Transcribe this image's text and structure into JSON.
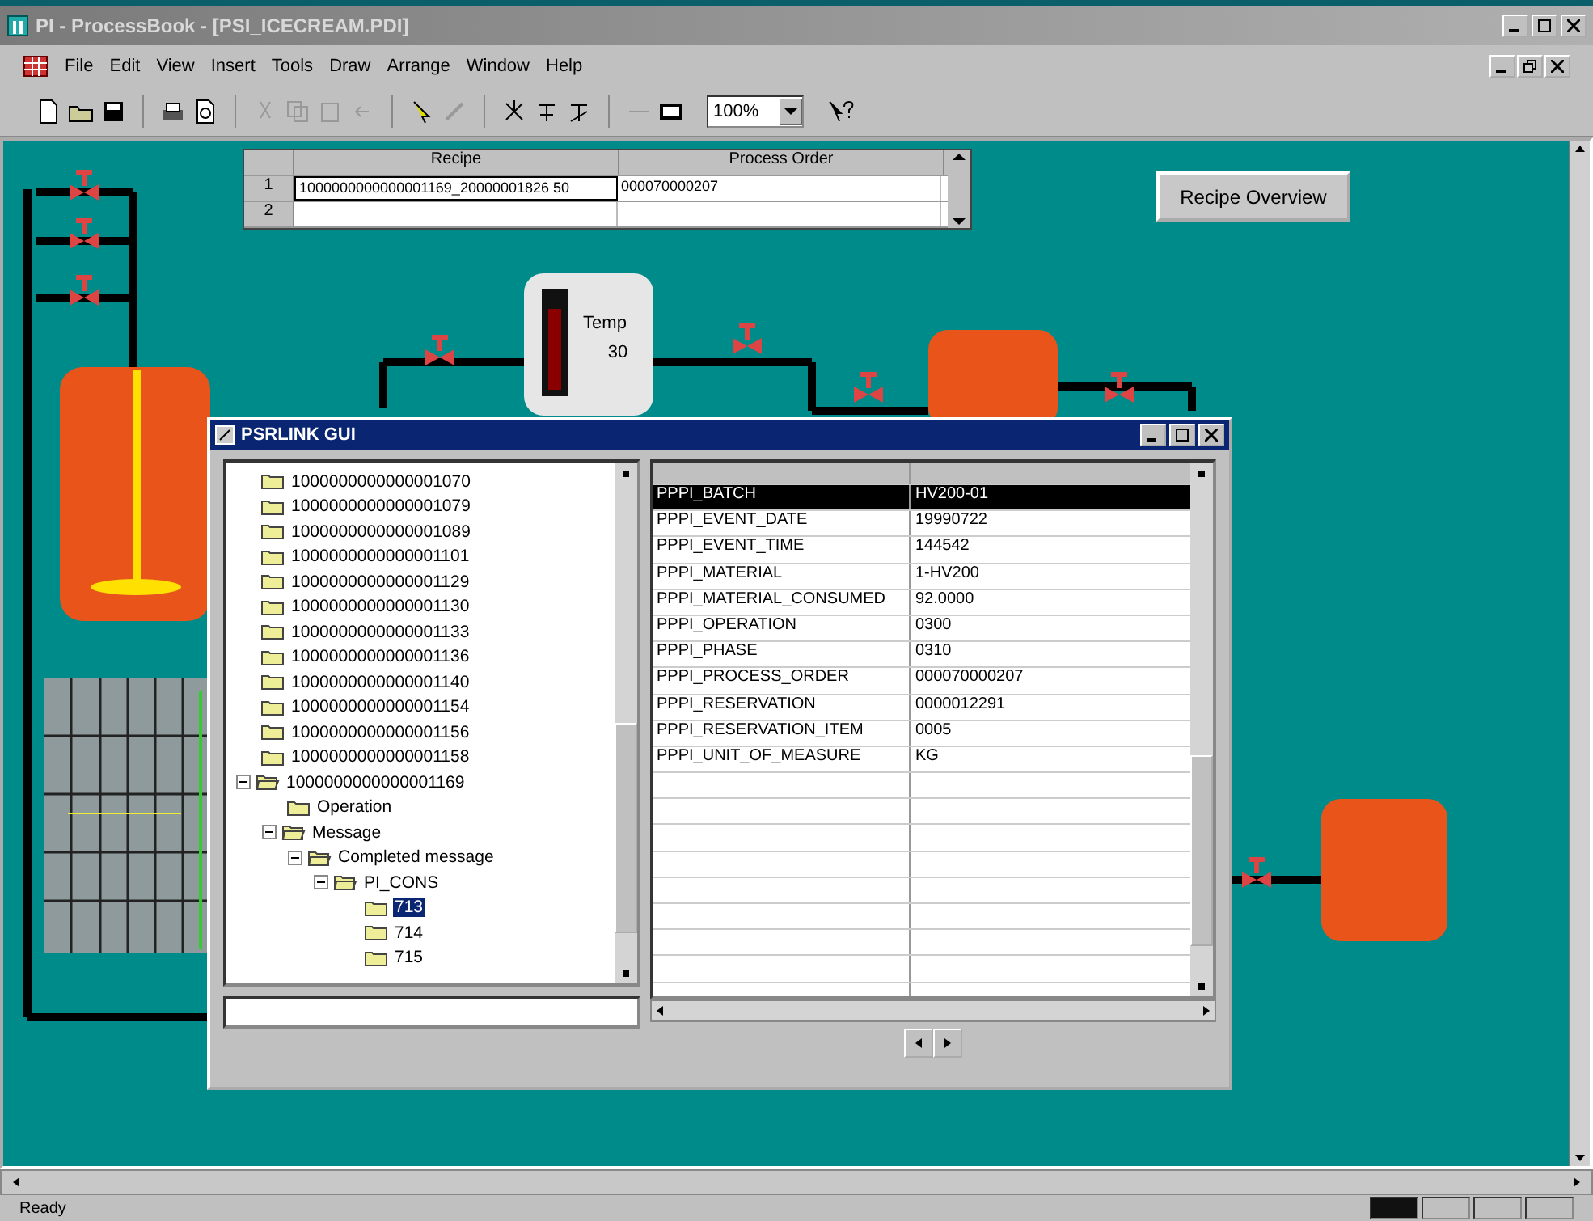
{
  "window": {
    "title": "PI - ProcessBook - [PSI_ICECREAM.PDI]"
  },
  "menu": [
    "File",
    "Edit",
    "View",
    "Insert",
    "Tools",
    "Draw",
    "Arrange",
    "Window",
    "Help"
  ],
  "toolbar": {
    "zoom": "100%"
  },
  "recipe_grid": {
    "columns": [
      "Recipe",
      "Process Order"
    ],
    "rows": [
      {
        "number": "1",
        "recipe": "1000000000000001169_20000001826 50",
        "process_order": "000070000207",
        "selected": true
      },
      {
        "number": "2",
        "selected": false
      }
    ]
  },
  "recipe_overview_button": "Recipe Overview",
  "temp_tank": {
    "label": "Temp",
    "value": "30"
  },
  "dialog": {
    "title": "PSRLINK GUI",
    "tree": [
      {
        "label": "1000000000000001070",
        "selected": false
      },
      {
        "label": "1000000000000001079",
        "selected": false
      },
      {
        "label": "1000000000000001089",
        "selected": false
      },
      {
        "label": "1000000000000001101",
        "selected": false
      },
      {
        "label": "1000000000000001129",
        "selected": false
      },
      {
        "label": "1000000000000001130",
        "selected": false
      },
      {
        "label": "1000000000000001133",
        "selected": false
      },
      {
        "label": "1000000000000001136",
        "selected": false
      },
      {
        "label": "1000000000000001140",
        "selected": false
      },
      {
        "label": "1000000000000001154",
        "selected": false
      },
      {
        "label": "1000000000000001156",
        "selected": false
      },
      {
        "label": "1000000000000001158",
        "selected": false
      },
      {
        "label": "1000000000000001169",
        "selected": false,
        "expanded": true,
        "children": [
          {
            "label": "Operation",
            "selected": false
          },
          {
            "label": "Message",
            "selected": false,
            "expanded": true,
            "children": [
              {
                "label": "Completed message",
                "selected": false,
                "expanded": true,
                "children": [
                  {
                    "label": "PI_CONS",
                    "selected": false,
                    "expanded": true,
                    "children": [
                      {
                        "label": "713",
                        "selected": true
                      },
                      {
                        "label": "714",
                        "selected": false
                      },
                      {
                        "label": "715",
                        "selected": false
                      }
                    ]
                  }
                ]
              }
            ]
          }
        ]
      }
    ],
    "table": {
      "rows": [
        {
          "name": "PPPI_BATCH",
          "value": "HV200-01",
          "selected": true
        },
        {
          "name": "PPPI_EVENT_DATE",
          "value": "19990722",
          "selected": false
        },
        {
          "name": "PPPI_EVENT_TIME",
          "value": "144542",
          "selected": false
        },
        {
          "name": "PPPI_MATERIAL",
          "value": "1-HV200",
          "selected": false
        },
        {
          "name": "PPPI_MATERIAL_CONSUMED",
          "value": "92.0000",
          "selected": false
        },
        {
          "name": "PPPI_OPERATION",
          "value": "0300",
          "selected": false
        },
        {
          "name": "PPPI_PHASE",
          "value": "0310",
          "selected": false
        },
        {
          "name": "PPPI_PROCESS_ORDER",
          "value": "000070000207",
          "selected": false
        },
        {
          "name": "PPPI_RESERVATION",
          "value": "0000012291",
          "selected": false
        },
        {
          "name": "PPPI_RESERVATION_ITEM",
          "value": "0005",
          "selected": false
        },
        {
          "name": "PPPI_UNIT_OF_MEASURE",
          "value": "KG",
          "selected": false
        }
      ]
    }
  },
  "status_bar": {
    "text": "Ready"
  }
}
